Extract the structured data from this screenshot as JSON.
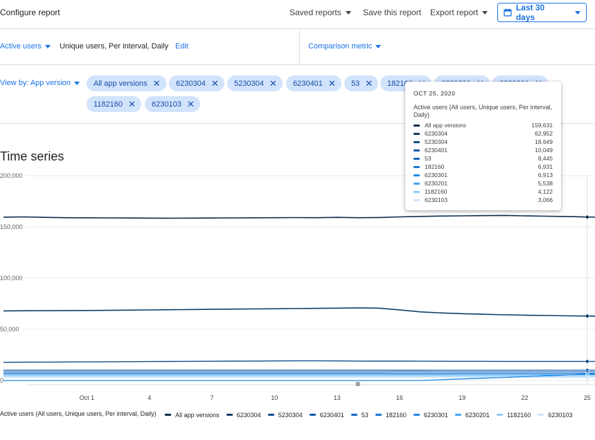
{
  "toolbar": {
    "title": "Configure report",
    "saved_reports": "Saved reports",
    "save_report": "Save this report",
    "export_report": "Export report",
    "date_range": "Last 30 days"
  },
  "metric_row": {
    "metric": "Active users",
    "metric_desc": "Unique users, Per interval, Daily",
    "edit": "Edit",
    "comparison": "Comparison metric"
  },
  "filter_row": {
    "view_by": "View by: App version",
    "chips": [
      "All app versions",
      "6230304",
      "5230304",
      "6230401",
      "53",
      "182160",
      "6230301",
      "6230201",
      "1182160",
      "6230103"
    ]
  },
  "section_title": "Time series",
  "colors": {
    "accent": "#1a73e8",
    "chip_bg": "#d2e3fc"
  },
  "chart_data": {
    "type": "line",
    "ylim": [
      0,
      200000
    ],
    "y_ticks": [
      "200,000",
      "150,000",
      "100,000",
      "50,000",
      "0"
    ],
    "y_tick_values": [
      200000,
      150000,
      100000,
      50000,
      0
    ],
    "x_tick_labels": [
      "Oct 1",
      "4",
      "7",
      "10",
      "13",
      "16",
      "19",
      "22",
      "25"
    ],
    "x_tick_days": [
      5,
      8,
      11,
      14,
      17,
      20,
      23,
      26,
      29
    ],
    "x_start_label": "Sep 27",
    "hover_day": 29,
    "series": [
      {
        "name": "All app versions",
        "color": "#0b2a4a",
        "width": 1.6,
        "values": [
          159500,
          159800,
          159300,
          159000,
          158900,
          158800,
          158700,
          158600,
          158500,
          158600,
          158700,
          158800,
          158900,
          159000,
          159100,
          159000,
          159300,
          159000,
          159200,
          159800,
          160300,
          160600,
          160800,
          161000,
          161200,
          160800,
          160500,
          160200,
          159631,
          159300
        ]
      },
      {
        "name": "6230304",
        "color": "#0b3d66",
        "width": 1.6,
        "values": [
          68000,
          68100,
          68200,
          68300,
          68400,
          68500,
          68700,
          68900,
          69100,
          69300,
          69500,
          69700,
          69900,
          70100,
          70300,
          70500,
          70700,
          70900,
          70700,
          69000,
          67000,
          66000,
          65300,
          64700,
          64200,
          63800,
          63500,
          63200,
          62952,
          62700
        ]
      },
      {
        "name": "5230304",
        "color": "#0d4f8b",
        "width": 1.4,
        "values": [
          17800,
          17900,
          18000,
          18100,
          18200,
          18300,
          18400,
          18500,
          18600,
          18700,
          18800,
          18900,
          19000,
          19100,
          19200,
          19200,
          19100,
          19000,
          18950,
          18900,
          18850,
          18800,
          18750,
          18700,
          18680,
          18660,
          18650,
          18640,
          18649,
          18600
        ]
      },
      {
        "name": "6230401",
        "color": "#1058a8",
        "width": 1.3,
        "values": [
          10000,
          10000,
          10000,
          10000,
          10000,
          10000,
          10000,
          10000,
          10000,
          10000,
          10000,
          10000,
          10000,
          10000,
          10000,
          10000,
          10000,
          10000,
          10000,
          10020,
          10030,
          10040,
          10045,
          10050,
          10050,
          10050,
          10050,
          10049,
          10049,
          10049
        ]
      },
      {
        "name": "53",
        "color": "#1565c0",
        "width": 1.3,
        "values": [
          8400,
          8400,
          8400,
          8400,
          8400,
          8400,
          8400,
          8400,
          8400,
          8400,
          8400,
          8400,
          8400,
          8400,
          8400,
          8400,
          8400,
          8400,
          8400,
          8420,
          8430,
          8440,
          8445,
          8445,
          8445,
          8445,
          8445,
          8445,
          8445,
          8445
        ]
      },
      {
        "name": "182160",
        "color": "#1976d2",
        "width": 1.3,
        "values": [
          6900,
          6900,
          6900,
          6900,
          6900,
          6900,
          6900,
          6900,
          6900,
          6900,
          6900,
          6900,
          6900,
          6900,
          6900,
          6900,
          6900,
          6900,
          6900,
          6910,
          6920,
          6925,
          6930,
          6931,
          6931,
          6931,
          6931,
          6931,
          6931,
          6931
        ]
      },
      {
        "name": "6230301",
        "color": "#1e88e5",
        "width": 1.3,
        "values": [
          0,
          0,
          0,
          0,
          0,
          0,
          0,
          0,
          0,
          0,
          0,
          0,
          0,
          0,
          0,
          0,
          0,
          0,
          0,
          0,
          0,
          800,
          1500,
          2200,
          3000,
          3800,
          4600,
          5400,
          6200,
          6913
        ]
      },
      {
        "name": "6230201",
        "color": "#42a5f5",
        "width": 1.3,
        "values": [
          5500,
          5500,
          5500,
          5500,
          5500,
          5500,
          5500,
          5500,
          5500,
          5500,
          5500,
          5500,
          5500,
          5500,
          5500,
          5500,
          5500,
          5500,
          5500,
          5510,
          5520,
          5530,
          5535,
          5538,
          5538,
          5538,
          5538,
          5538,
          5538,
          5538
        ]
      },
      {
        "name": "1182160",
        "color": "#90caf9",
        "width": 1.3,
        "values": [
          4100,
          4100,
          4100,
          4100,
          4100,
          4100,
          4100,
          4100,
          4100,
          4100,
          4100,
          4100,
          4100,
          4100,
          4100,
          4100,
          4100,
          4100,
          4100,
          4110,
          4115,
          4120,
          4122,
          4122,
          4122,
          4122,
          4122,
          4122,
          4122,
          4122
        ]
      },
      {
        "name": "6230103",
        "color": "#cfe5fb",
        "width": 1.3,
        "values": [
          3000,
          3000,
          3000,
          3000,
          3000,
          3000,
          3000,
          3000,
          3000,
          3000,
          3000,
          3000,
          3000,
          3000,
          3000,
          3000,
          3000,
          3000,
          3000,
          3030,
          3050,
          3060,
          3065,
          3066,
          3066,
          3066,
          3066,
          3066,
          3066,
          3066
        ]
      }
    ],
    "legend_prefix": "Active users (All users, Unique users, Per interval, Daily)"
  },
  "tooltip": {
    "date": "OCT 25, 2020",
    "desc": "Active users (All users, Unique users, Per interval, Daily)",
    "rows": [
      {
        "name": "All app versions",
        "value": "159,631",
        "color": "#0b2a4a"
      },
      {
        "name": "6230304",
        "value": "62,952",
        "color": "#0b3d66"
      },
      {
        "name": "5230304",
        "value": "18,649",
        "color": "#0d4f8b"
      },
      {
        "name": "6230401",
        "value": "10,049",
        "color": "#1058a8"
      },
      {
        "name": "53",
        "value": "8,445",
        "color": "#1565c0"
      },
      {
        "name": "182160",
        "value": "6,931",
        "color": "#1976d2"
      },
      {
        "name": "6230301",
        "value": "6,913",
        "color": "#1e88e5"
      },
      {
        "name": "6230201",
        "value": "5,538",
        "color": "#42a5f5"
      },
      {
        "name": "1182160",
        "value": "4,122",
        "color": "#90caf9"
      },
      {
        "name": "6230103",
        "value": "3,066",
        "color": "#cfe5fb"
      }
    ]
  }
}
